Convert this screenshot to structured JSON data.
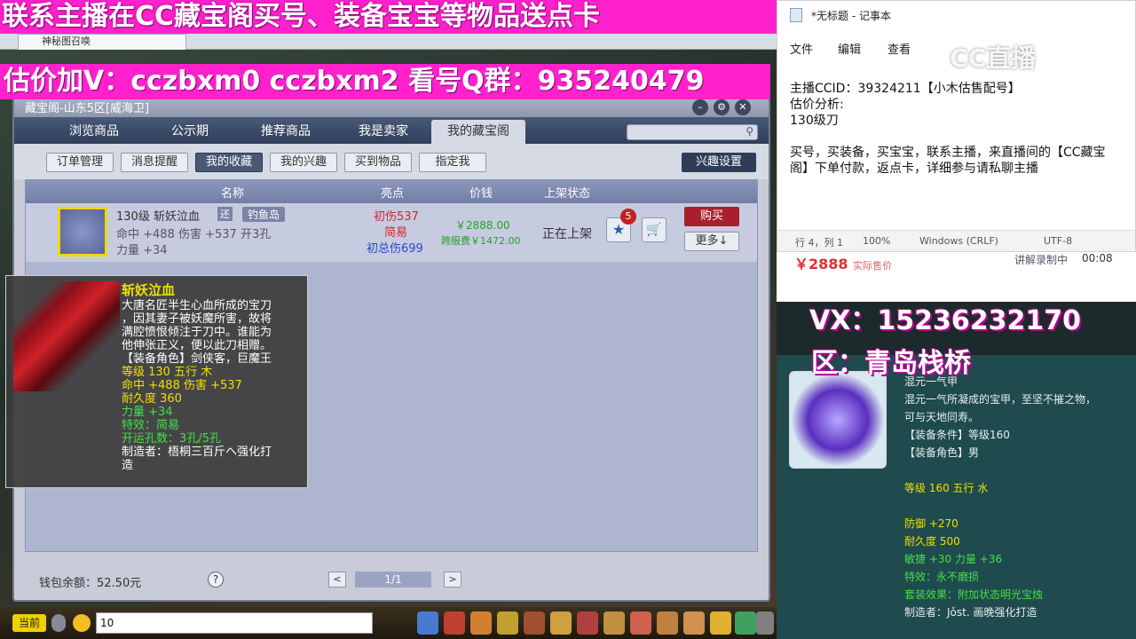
{
  "banners": {
    "top": "联系主播在CC藏宝阁买号、装备宝宝等物品送点卡",
    "price": "估价加V：cczbxm0  cczbxm2  看号Q群：935240479"
  },
  "browser": {
    "tab_label": "神秘图召唤"
  },
  "window": {
    "title": "藏宝阁-山东5区[威海卫]",
    "nav_tabs": [
      "浏览商品",
      "公示期",
      "推荐商品",
      "我是卖家",
      "我的藏宝阁"
    ],
    "sub_buttons": [
      "订单管理",
      "消息提醒",
      "我的收藏",
      "我的兴趣",
      "买到物品",
      "指定我"
    ],
    "interest_button": "兴趣设置",
    "columns": [
      "名称",
      "亮点",
      "价钱",
      "上架状态"
    ],
    "item": {
      "level_name": "130级  斩妖泣血",
      "tag_return": "还",
      "tag_server": "钓鱼岛",
      "stat_line1": "命中 +488  伤害 +537  开3孔",
      "stat_line2": "力量 +34",
      "highlight1": "初伤537",
      "highlight2": "简易",
      "highlight3": "初总伤699",
      "price": "￥2888.00",
      "cross_fee": "跨服费￥1472.00",
      "status": "正在上架",
      "fav_count": "5",
      "buy": "购买",
      "more": "更多↓"
    },
    "wallet": "钱包余额：52.50元",
    "help": "?",
    "page": "1/1",
    "prev": "<",
    "next": ">"
  },
  "tooltip": {
    "name": "斩妖泣血",
    "desc": [
      "大唐名匠半生心血所成的宝刀",
      "，因其妻子被妖魔所害，故将",
      "满腔愤恨倾注于刀中。谁能为",
      "他伸张正义，便以此刀相赠。"
    ],
    "role": "【装备角色】剑侠客，巨魔王",
    "level": "等级 130  五行 木",
    "hit": "命中 +488  伤害 +537",
    "durability": "耐久度 360",
    "str": "力量 +34",
    "effect": "特效：简易",
    "holes": "开运孔数：3孔/5孔",
    "maker1": "制造者：梧桐三百斤ヘ强化打",
    "maker2": "造"
  },
  "taskbar": {
    "chat_label": "当前",
    "chat_value": "10"
  },
  "notepad": {
    "title": "*无标题 - 记事本",
    "menu": [
      "文件",
      "编辑",
      "查看"
    ],
    "lines": [
      "主播CCID：39324211【小木估售配号】",
      "估价分析:",
      "130级刀",
      "",
      "买号，买装备，买宝宝，联系主播，来直播间的【CC藏宝",
      "阁】下单付款，返点卡，详细参与请私聊主播"
    ],
    "status": [
      "行 4，列 1",
      "100%",
      "Windows (CRLF)",
      "UTF-8"
    ]
  },
  "cc_logo": "CC直播",
  "stream": {
    "price": "￥2888",
    "price_note": "实际售价",
    "label": "讲解录制中",
    "timer": "00:08",
    "vx": "VX：15236232170",
    "zone": "区：青岛栈桥"
  },
  "armor": {
    "name": "混元一气甲",
    "desc1": "混元一气所凝成的宝甲，至坚不摧之物，",
    "desc2": "可与天地同寿。",
    "cond": "【装备条件】等级160",
    "role": "【装备角色】男",
    "level": "等级 160  五行 水",
    "def": "防御 +270",
    "dur": "耐久度 500",
    "agi": "敏捷 +30  力量 +36",
    "effect": "特效：永不磨损",
    "set": "套装效果：附加状态明光宝烛",
    "maker": "制造者：Jǒst. 画晚强化打造"
  },
  "colors": {
    "banner": "#ff22cc",
    "accent_red": "#a8202c",
    "yellow_stat": "#f0e000",
    "green_stat": "#44e044"
  }
}
